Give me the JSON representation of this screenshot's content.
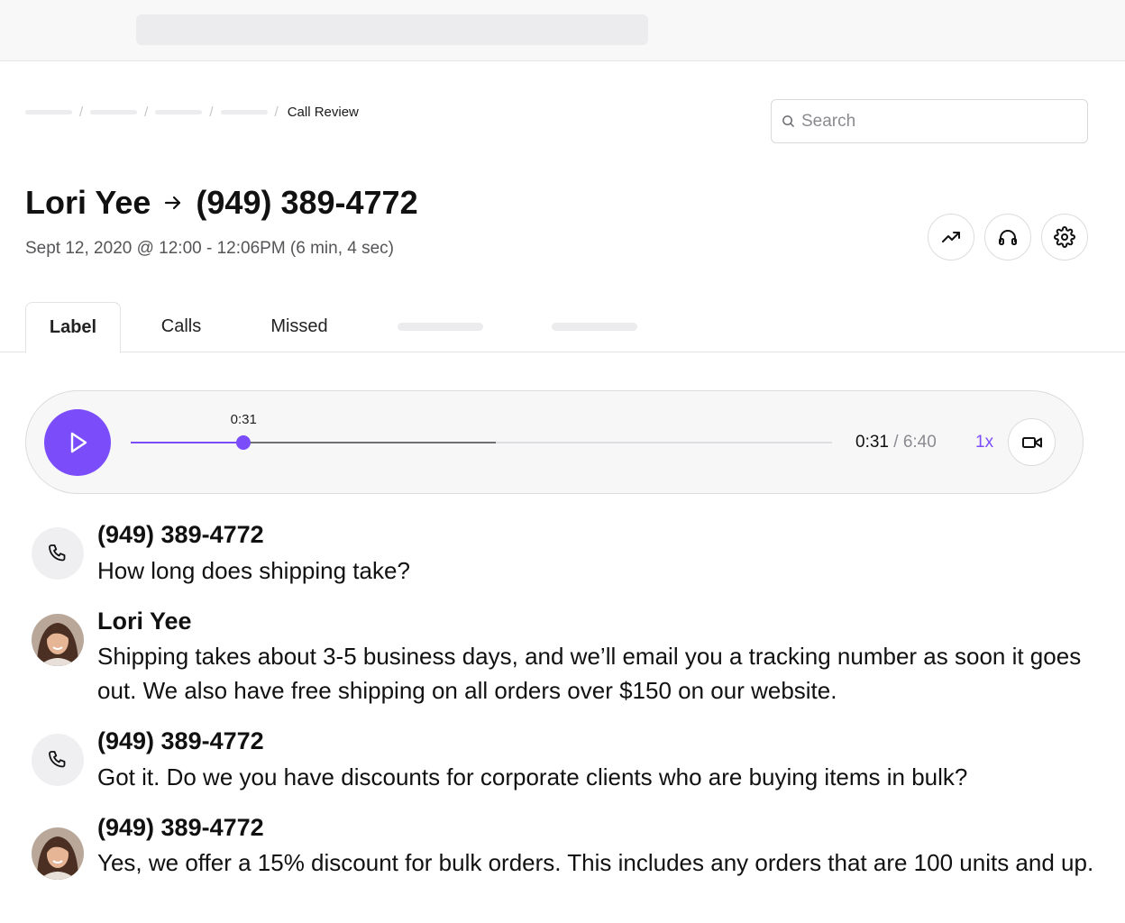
{
  "breadcrumb": {
    "current": "Call Review"
  },
  "search": {
    "placeholder": "Search"
  },
  "header": {
    "caller": "Lori Yee",
    "callee": "(949) 389-4772",
    "subtitle": "Sept 12, 2020 @ 12:00 - 12:06PM (6 min, 4 sec)"
  },
  "actions": {
    "icons": [
      "trending-up-icon",
      "headphones-icon",
      "settings-gear-icon"
    ]
  },
  "tabs": [
    {
      "label": "Label",
      "active": true
    },
    {
      "label": "Calls",
      "active": false
    },
    {
      "label": "Missed",
      "active": false
    }
  ],
  "player": {
    "thumb_time": "0:31",
    "current_time": "0:31",
    "separator": "/",
    "total_time": "6:40",
    "speed": "1x",
    "played_fraction": 0.161,
    "buffered_fraction": 0.52,
    "accent": "#7b4dfa"
  },
  "transcript": [
    {
      "speaker": "(949) 389-4772",
      "avatar": "phone-icon",
      "text": "How long does shipping take?"
    },
    {
      "speaker": "Lori Yee",
      "avatar": "agent-photo",
      "text": "Shipping takes about 3-5 business days, and we’ll email you a tracking number as soon it goes out. We also have free shipping on all orders over $150 on our website."
    },
    {
      "speaker": "(949) 389-4772",
      "avatar": "phone-icon",
      "text": "Got it. Do we you have discounts for corporate clients who are buying items in bulk?"
    },
    {
      "speaker": "(949) 389-4772",
      "avatar": "agent-photo",
      "text": "Yes, we offer a 15% discount for bulk orders. This includes any orders that are 100 units and up."
    }
  ]
}
